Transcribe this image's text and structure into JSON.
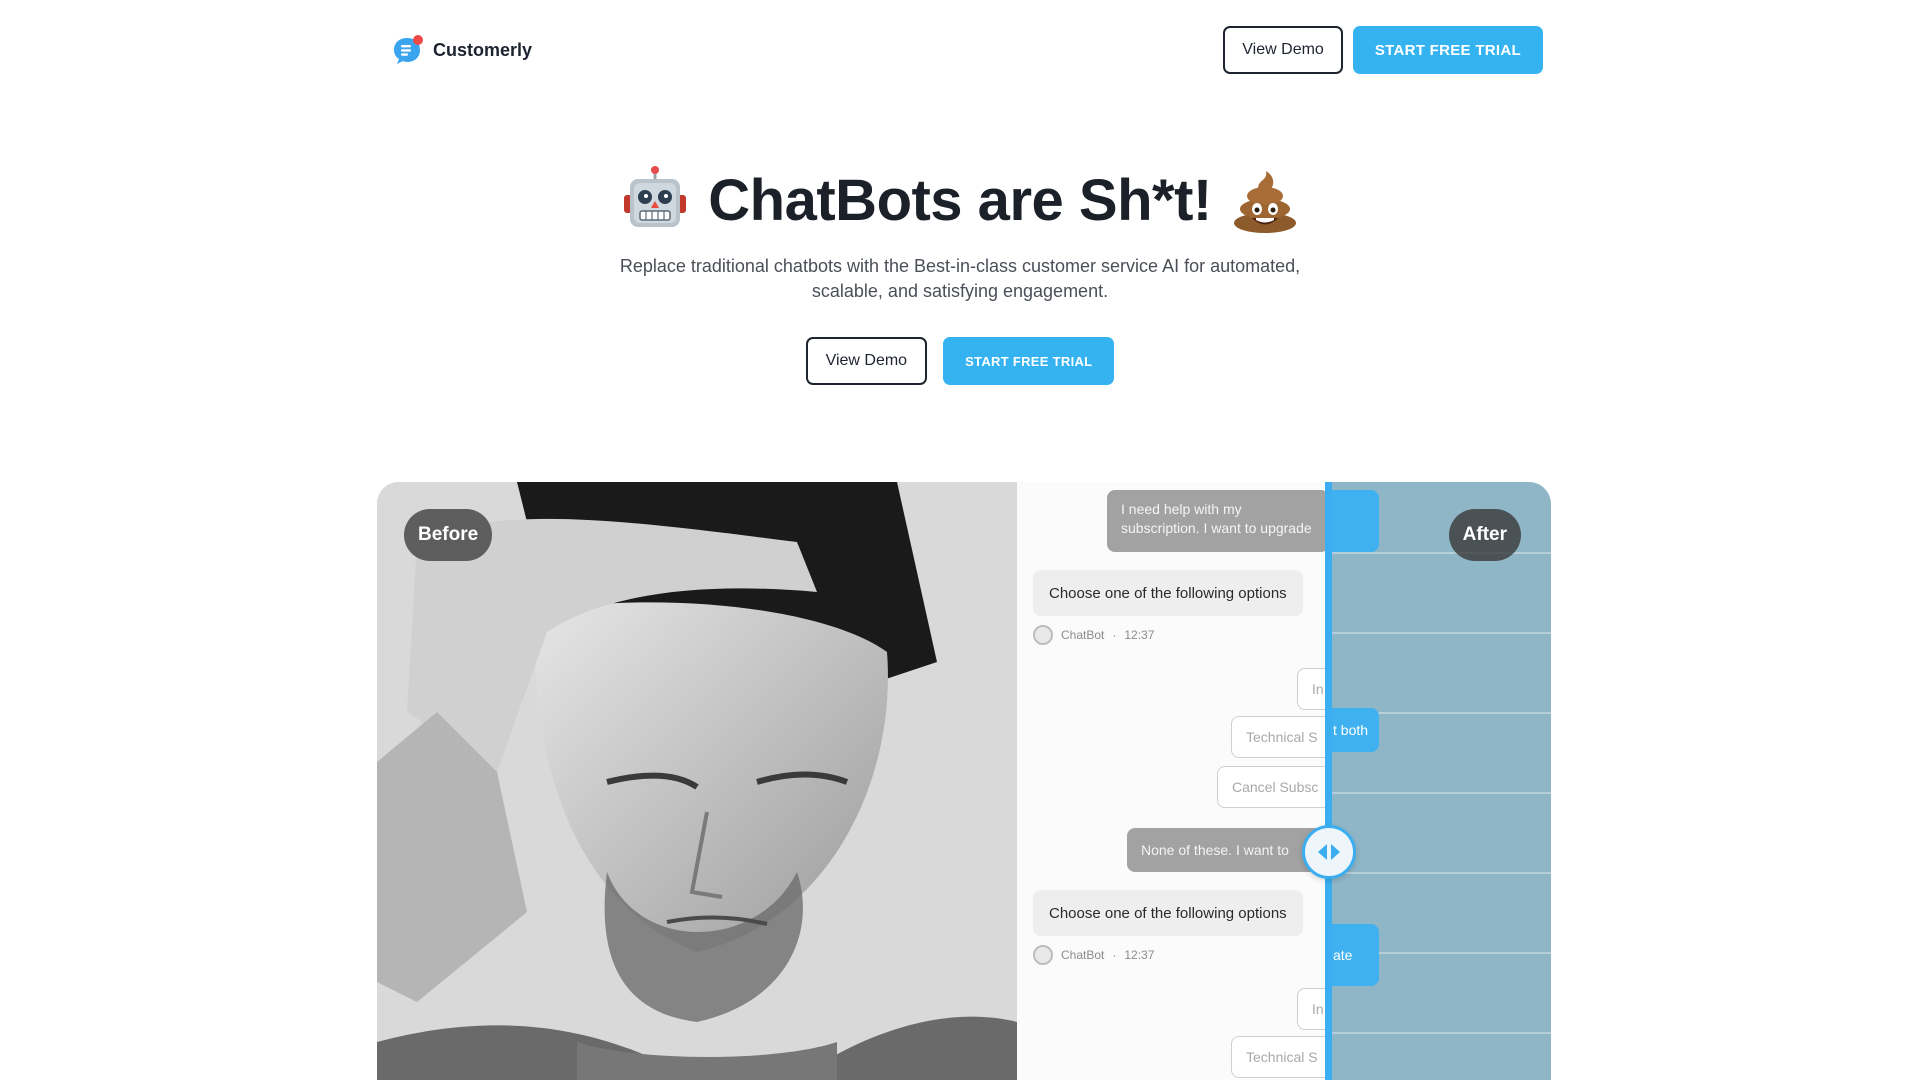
{
  "brand": {
    "name": "Customerly"
  },
  "header": {
    "view_demo": "View Demo",
    "start_trial": "START FREE TRIAL"
  },
  "hero": {
    "title": "ChatBots are Sh*t!",
    "subtitle": "Replace traditional chatbots with the Best-in-class customer service AI for automated, scalable, and satisfying engagement.",
    "view_demo": "View Demo",
    "start_trial": "START FREE TRIAL",
    "emoji_left": "robot-emoji",
    "emoji_right": "poop-emoji"
  },
  "compare": {
    "before_label": "Before",
    "after_label": "After",
    "chat": {
      "user_msg_1": "I need help with my subscription. I want to upgrade",
      "bot_msg_1": "Choose one of the following options",
      "meta_sender_1": "ChatBot",
      "meta_time_1": "12:37",
      "option_1": "In",
      "option_2": "Technical S",
      "option_3": "Cancel Subsc",
      "user_msg_2": "None of these. I want to",
      "bot_msg_2": "Choose one of the following options",
      "meta_sender_2": "ChatBot",
      "meta_time_2": "12:37",
      "option_4": "In",
      "option_5": "Technical S",
      "after_msg_1": "t both",
      "after_msg_2": "ate"
    }
  },
  "colors": {
    "accent": "#35b3f1",
    "dark": "#1e2530"
  }
}
